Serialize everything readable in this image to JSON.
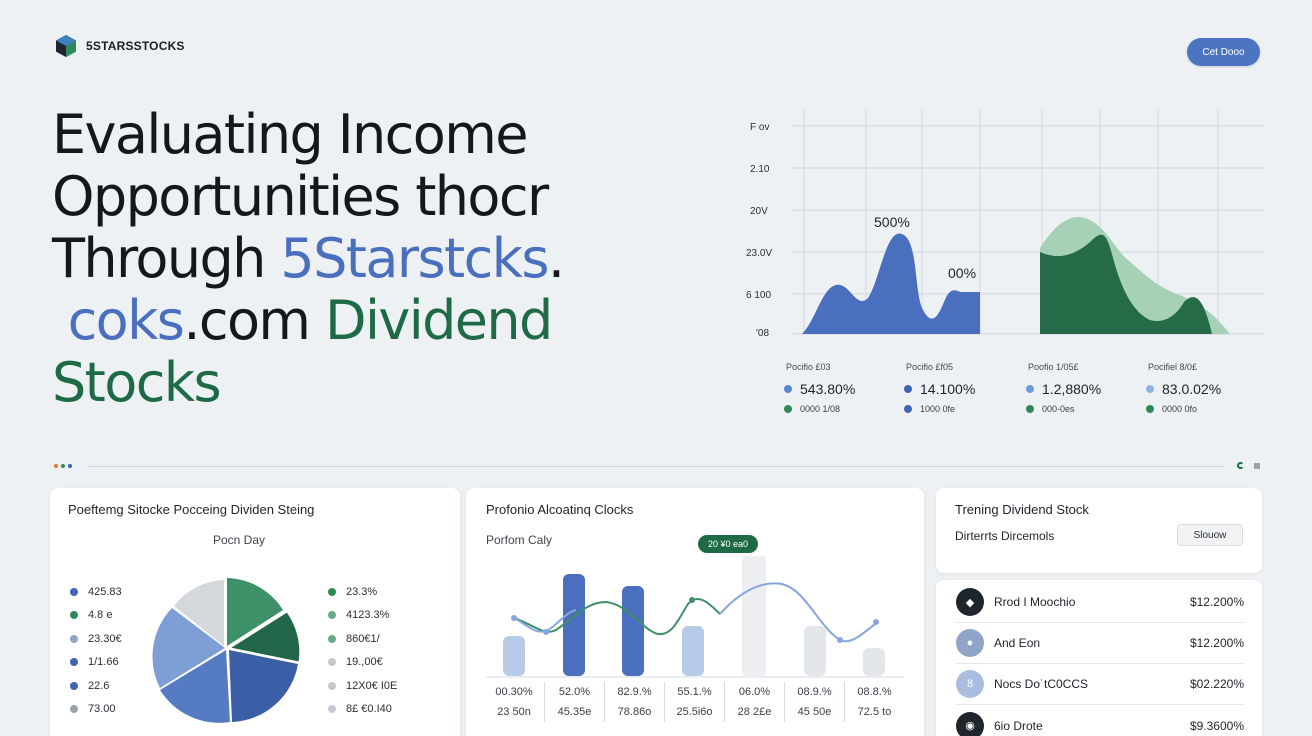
{
  "brand": {
    "name": "5STARSSTOCKS",
    "cta_label": "Cet Dooo"
  },
  "hero": {
    "line1": "Evaluating Income",
    "line2": "Opportunities thocr",
    "line3_a": "Through ",
    "line3_b": "5Starstcks",
    "line3_c": ".",
    "line4_a": " coks",
    "line4_b": ".com ",
    "line4_c": "Dividend",
    "line5": "Stocks"
  },
  "top_chart": {
    "y_labels": [
      "F ov",
      "2.10",
      "20V",
      "23.0V",
      "6 100",
      "'08"
    ],
    "annotation_1": "500%",
    "annotation_2": "00%",
    "colors": {
      "blue": "#4a6fbe",
      "green": "#256b48",
      "light_green": "#a7d1b6"
    }
  },
  "stats": [
    {
      "caption": "Pocifio £03",
      "value": "543.80%",
      "sub": "0000 1/08",
      "dot1": "#5b86cf",
      "dot2": "#2f8a5a"
    },
    {
      "caption": "Pocifio £f05",
      "value": "14.100%",
      "sub": "1000 0fe",
      "dot1": "#3e64b5",
      "dot2": "#3e64b5"
    },
    {
      "caption": "Poofio 1/05£",
      "value": "1.2,880%",
      "sub": "000-0es",
      "dot1": "#6f9ad8",
      "dot2": "#2f8a5a"
    },
    {
      "caption": "Pocifiel 8/0£",
      "value": "83.0.02%",
      "sub": "0000 0fo",
      "dot1": "#8fb1e3",
      "dot2": "#2f8a5a"
    }
  ],
  "card_allocation": {
    "title": "Poeftemg Sitocke Pocceing Dividen Steing",
    "subtitle": "Pocn Day",
    "legend_left": [
      {
        "label": "425.83",
        "color": "#3e64b5"
      },
      {
        "label": "4.8 e",
        "color": "#2f8a5a"
      },
      {
        "label": "23.30€",
        "color": "#8fa5c8"
      },
      {
        "label": "1/1.66",
        "color": "#3e64b5"
      },
      {
        "label": "22.6",
        "color": "#3e64b5"
      },
      {
        "label": "73.00",
        "color": "#9aa1a9"
      }
    ],
    "legend_right": [
      {
        "label": "23.3%",
        "color": "#2f8a5a"
      },
      {
        "label": "4123.3%",
        "color": "#6aa987"
      },
      {
        "label": "860€1/",
        "color": "#6aa987"
      },
      {
        "label": "19.,00€",
        "color": "#c5cad0"
      },
      {
        "label": "12X0€ I0E",
        "color": "#c5cad0"
      },
      {
        "label": "8£ €0.I40",
        "color": "#c5cad0"
      }
    ]
  },
  "card_portfolio": {
    "title": "Profonio Alcoatinq Clocks",
    "subtitle": "Porfom Caly",
    "badge": "20 ¥0 ea0",
    "cols": [
      {
        "top": "00.30%",
        "bottom": "23 50n"
      },
      {
        "top": "52.0%",
        "bottom": "45.35e"
      },
      {
        "top": "82.9.%",
        "bottom": "78.86o"
      },
      {
        "top": "55.1.%",
        "bottom": "25.5i6o"
      },
      {
        "top": "06.0%",
        "bottom": "28 2£e"
      },
      {
        "top": "08.9.%",
        "bottom": "45 50e"
      },
      {
        "top": "08.8.%",
        "bottom": "72.5 to"
      }
    ]
  },
  "card_trending": {
    "title": "Trening Dividend Stock",
    "subtitle": "Dirterrts Dircemols",
    "button": "Slouow"
  },
  "trending_list": [
    {
      "name": "Rrod I Moochio",
      "value": "$12.200%",
      "icon_bg": "#1f252c",
      "icon_glyph": "◆"
    },
    {
      "name": "And Eon",
      "value": "$12.200%",
      "icon_bg": "#8fa5c8",
      "icon_glyph": "●"
    },
    {
      "name": "Nocs Do˙tC0CCS",
      "value": "$02.220%",
      "icon_bg": "#a9bde0",
      "icon_glyph": "8"
    },
    {
      "name": "6io Drote",
      "value": "$9.3600%",
      "icon_bg": "#1f252c",
      "icon_glyph": "◉"
    }
  ]
}
